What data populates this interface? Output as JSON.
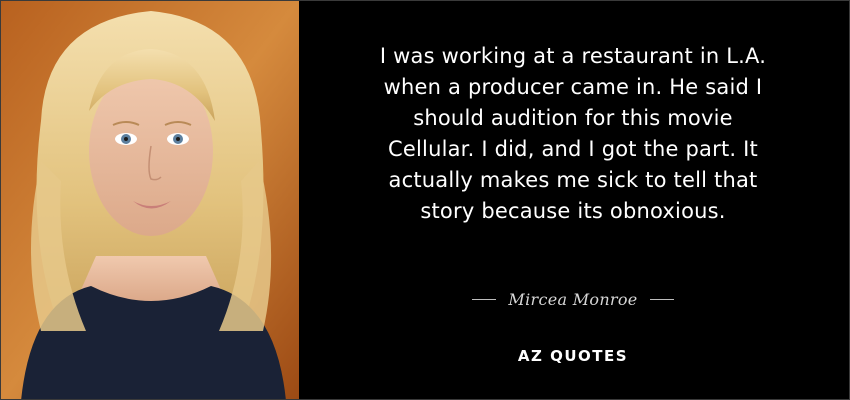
{
  "quote": {
    "lines": [
      "I was working at a restaurant in L.A.",
      "when a producer came in. He said I",
      "should audition for this movie",
      "Cellular. I did, and I got the part. It",
      "actually makes me sick to tell that",
      "story because its obnoxious."
    ]
  },
  "author": {
    "name": "Mircea Monroe"
  },
  "brand": {
    "logo_text": "AZ QUOTES"
  },
  "colors": {
    "background": "#000000",
    "quote_text": "#ffffff",
    "author_text": "#d6d6d6"
  }
}
